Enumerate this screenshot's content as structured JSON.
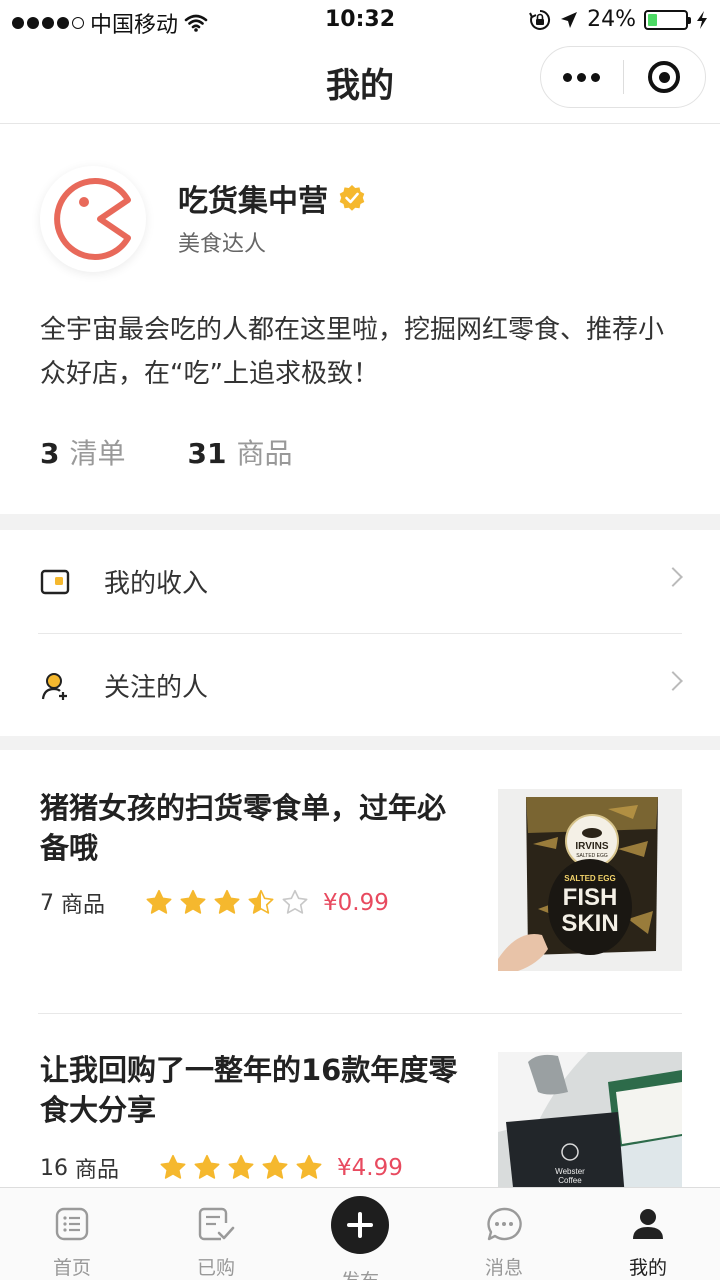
{
  "status_bar": {
    "carrier": "中国移动",
    "time": "10:32",
    "battery": "24%",
    "battery_level": 0.24
  },
  "nav": {
    "title": "我的"
  },
  "profile": {
    "name": "吃货集中营",
    "role": "美食达人",
    "bio": "全宇宙最会吃的人都在这里啦，挖掘网红零食、推荐小众好店，在“吃”上追求极致！",
    "stats": [
      {
        "num": "3",
        "label": "清单"
      },
      {
        "num": "31",
        "label": "商品"
      }
    ],
    "avatar_color": "#e8695a",
    "verify_color": "#f5b82e"
  },
  "menu": {
    "items": [
      {
        "label": "我的收入",
        "icon": "wallet-icon"
      },
      {
        "label": "关注的人",
        "icon": "user-follow-icon"
      }
    ]
  },
  "lists": [
    {
      "title": "猪猪女孩的扫货零食单，过年必备哦",
      "count": "7",
      "count_label": "商品",
      "rating": 3.5,
      "price": "¥0.99",
      "thumb_text": {
        "brand": "IRVINS",
        "sub": "SALTED EGG",
        "line1": "SALTED EGG",
        "line2": "FISH",
        "line3": "SKIN"
      }
    },
    {
      "title": "让我回购了一整年的16款年度零食大分享",
      "count": "16",
      "count_label": "商品",
      "rating": 5,
      "price": "¥4.99",
      "thumb_text": {
        "brand": "Webster",
        "sub": "Coffee"
      }
    }
  ],
  "tabbar": {
    "tabs": [
      {
        "label": "首页",
        "icon": "home-list-icon"
      },
      {
        "label": "已购",
        "icon": "purchased-icon"
      },
      {
        "label": "发布",
        "icon": "plus-icon"
      },
      {
        "label": "消息",
        "icon": "message-icon"
      },
      {
        "label": "我的",
        "icon": "person-icon"
      }
    ],
    "active_index": 4
  },
  "colors": {
    "star": "#f5b82e",
    "price": "#e84a5f",
    "battery": "#4cd964"
  }
}
